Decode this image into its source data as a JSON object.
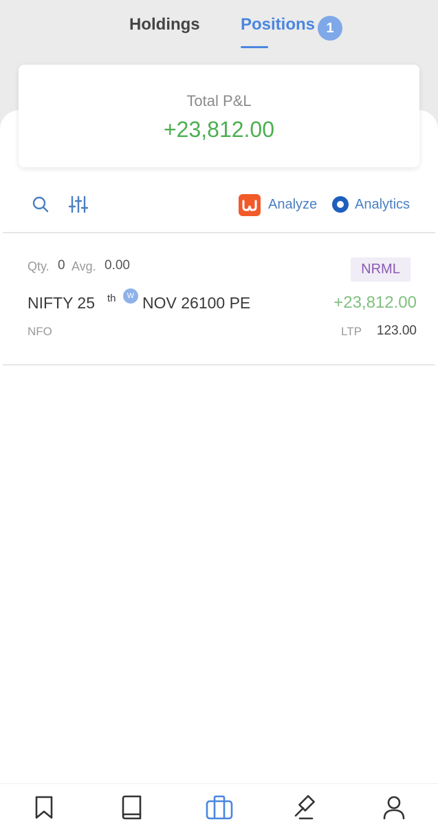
{
  "tabs": {
    "holdings": "Holdings",
    "positions": "Positions",
    "positions_count": "1"
  },
  "summary": {
    "label": "Total P&L",
    "value": "+23,812.00"
  },
  "toolbar": {
    "search_icon": "search-icon",
    "filter_icon": "sliders-icon",
    "analyze_label": "Analyze",
    "analytics_label": "Analytics"
  },
  "positions": [
    {
      "qty_label": "Qty.",
      "qty": "0",
      "avg_label": "Avg.",
      "avg": "0.00",
      "product": "NRML",
      "symbol_part1": "NIFTY 25",
      "symbol_sup": "th",
      "weekly_tag": "W",
      "symbol_part2": "NOV 26100 PE",
      "pnl": "+23,812.00",
      "exchange": "NFO",
      "ltp_label": "LTP",
      "ltp": "123.00"
    }
  ],
  "bottom_nav": [
    {
      "icon": "bookmark-icon"
    },
    {
      "icon": "book-icon"
    },
    {
      "icon": "briefcase-icon"
    },
    {
      "icon": "gavel-icon"
    },
    {
      "icon": "user-icon"
    }
  ],
  "colors": {
    "accent": "#4a86e0",
    "profit": "#4caf50",
    "analyze_brand": "#f15a29",
    "product_badge": "#8a5bb3"
  }
}
